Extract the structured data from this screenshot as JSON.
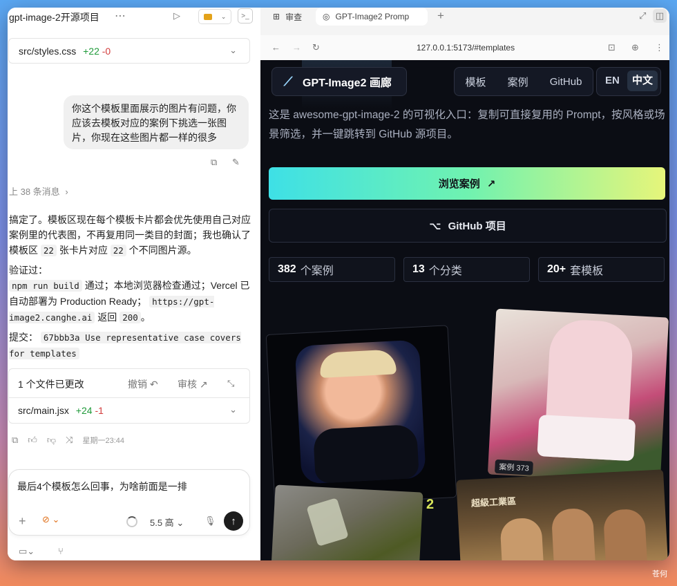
{
  "left": {
    "title": "gpt-image-2开源项目",
    "diff_top": {
      "file": "src/styles.css",
      "added": "+22",
      "removed": "-0"
    },
    "user_message": "你这个模板里面展示的图片有问题，你应该去模板对应的案例下挑选一张图片，你现在这些图片都一样的很多",
    "earlier_messages": "上 38 条消息",
    "reply_p1_a": "搞定了。模板区现在每个模板卡片都会优先使用自己对应案例里的代表图，不再复用同一类目的封面；我也确认了模板区 ",
    "reply_p1_code1": "22",
    "reply_p1_b": " 张卡片对应 ",
    "reply_p1_code2": "22",
    "reply_p1_c": " 个不同图片源。",
    "verify_label": "验证过：",
    "verify_code1": "npm run build",
    "verify_a": " 通过；本地浏览器检查通过；Vercel 已自动部署为 Production Ready； ",
    "verify_code2": "https://gpt-image2.canghe.ai",
    "verify_b": " 返回 ",
    "verify_code3": "200",
    "verify_c": "。",
    "commit_label": "提交： ",
    "commit_code": "67bbb3a Use representative case covers for templates",
    "changes_label": "1 个文件已更改",
    "undo_label": "撤销",
    "review_label": "审核",
    "diff_bottom": {
      "file": "src/main.jsx",
      "added": "+24",
      "removed": "-1"
    },
    "timestamp": "星期一23:44",
    "composer_text": "最后4个模板怎么回事，为啥前面是一排",
    "model_label": "5.5 高"
  },
  "browser": {
    "tab1": "审查",
    "tab2": "GPT-Image2 Promp",
    "url": "127.0.0.1:5173/#templates"
  },
  "site": {
    "brand": "GPT-Image2 画廊",
    "nav": [
      "模板",
      "案例",
      "GitHub"
    ],
    "lang_en": "EN",
    "lang_zh": "中文",
    "intro": "这是 awesome-gpt-image-2 的可视化入口：复制可直接复用的 Prompt，按风格或场景筛选，并一键跳转到 GitHub 源项目。",
    "cta_label": "浏览案例",
    "github_label": "GitHub 项目",
    "stats": [
      {
        "num": "382",
        "label": "个案例"
      },
      {
        "num": "13",
        "label": "个分类"
      },
      {
        "num": "20+",
        "label": "套模板"
      }
    ],
    "case_badge": "案例 373",
    "card_digit": "2",
    "poster_text": "超級工業區"
  },
  "desktop": {
    "watermark": "苍何"
  },
  "colors": {
    "accent_gradient_start": "#3ee0e6",
    "accent_gradient_end": "#e6f57a",
    "plus": "#1f9a3a",
    "minus": "#d23c3c",
    "bg_dark": "#0b0d14"
  }
}
